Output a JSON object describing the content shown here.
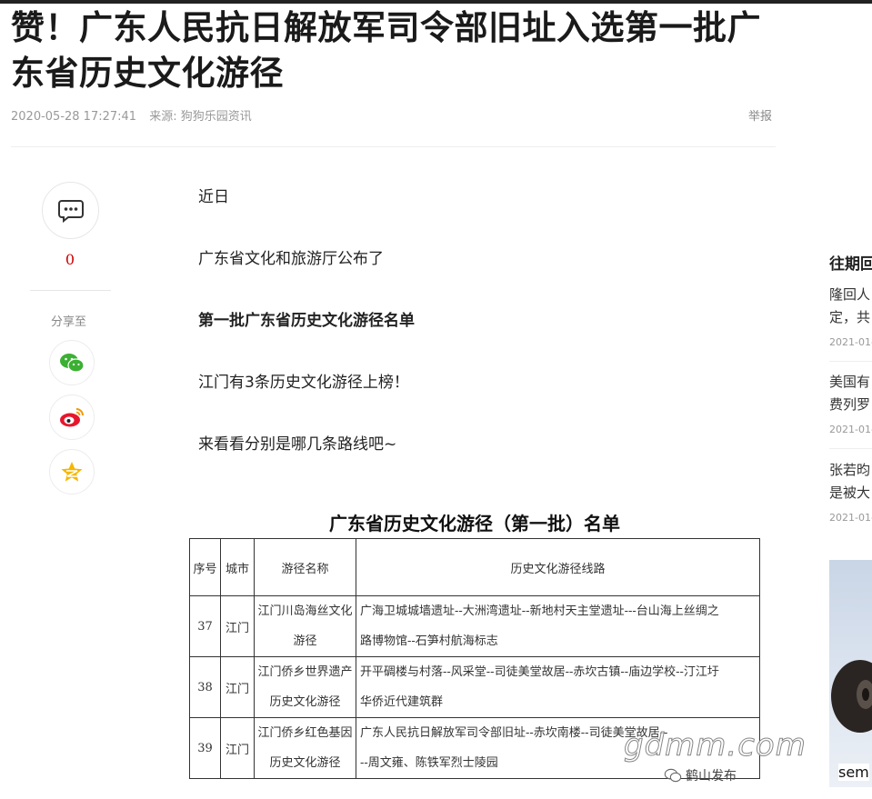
{
  "article": {
    "title_line1": "赞！广东人民抗日解放军司令部旧址入选第一批广",
    "title_line2": "东省历史文化游径",
    "datetime": "2020-05-28 17:27:41",
    "source": "来源: 狗狗乐园资讯",
    "report_label": "举报",
    "paragraphs": [
      "近日",
      "广东省文化和旅游厅公布了",
      "第一批广东省历史文化游径名单",
      "江门有3条历史文化游径上榜！",
      "来看看分别是哪几条路线吧~"
    ]
  },
  "share": {
    "comment_icon": "comment-bubble-icon",
    "comment_count": "0",
    "label": "分享至",
    "buttons": [
      {
        "icon": "wechat-icon",
        "color": "#3bb033"
      },
      {
        "icon": "weibo-icon",
        "color": "#e6162d"
      },
      {
        "icon": "qzone-star-icon",
        "color": "#f5b700"
      }
    ]
  },
  "route_list": {
    "title": "广东省历史文化游径（第一批）名单",
    "headers": [
      "序号",
      "城市",
      "游径名称",
      "历史文化游径线路"
    ],
    "rows": [
      {
        "no": "37",
        "city": "江门",
        "name_l1": "江门川岛海丝文化",
        "name_l2": "游径",
        "route_l1": "广海卫城城墙遗址--大洲湾遗址--新地村天主堂遗址---台山海上丝绸之",
        "route_l2": "路博物馆--石笋村航海标志"
      },
      {
        "no": "38",
        "city": "江门",
        "name_l1": "江门侨乡世界遗产",
        "name_l2": "历史文化游径",
        "route_l1": "开平碉楼与村落--风采堂--司徒美堂故居--赤坎古镇--庙边学校--汀江圩",
        "route_l2": "华侨近代建筑群"
      },
      {
        "no": "39",
        "city": "江门",
        "name_l1": "江门侨乡红色基因",
        "name_l2": "历史文化游径",
        "route_l1": "广东人民抗日解放军司令部旧址--赤坎南楼--司徒美堂故居--",
        "route_l2": "--周文雍、陈铁军烈士陵园"
      }
    ],
    "watermark": "gdmm.com",
    "watermark_source": "鹤山发布"
  },
  "sidebar": {
    "heading": "往期回",
    "items": [
      {
        "line1": "隆回人",
        "line2": "定，共",
        "date": "2021-01-"
      },
      {
        "line1": "美国有",
        "line2": "费列罗",
        "date": "2021-01-"
      },
      {
        "line1": "张若昀",
        "line2": "是被大",
        "date": "2021-01-"
      }
    ],
    "ad_text": "sem"
  },
  "colors": {
    "title": "#1a1a1a",
    "meta": "#999999",
    "comment_count": "#cc0000",
    "top_bar": "#222222"
  }
}
